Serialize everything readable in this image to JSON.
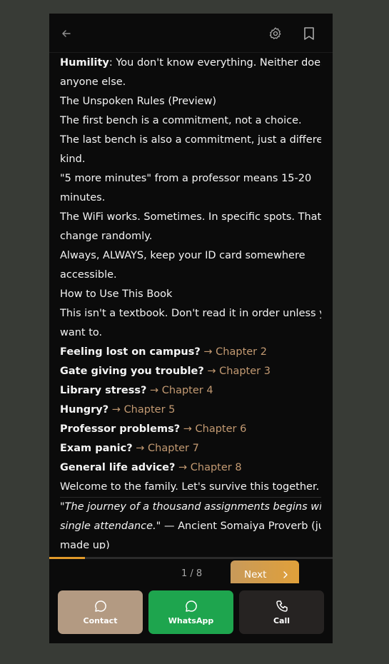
{
  "topbar": {
    "back_icon": "arrow-left-icon",
    "settings_icon": "gear-icon",
    "bookmark_icon": "bookmark-icon"
  },
  "content": {
    "humility_label": "Humility",
    "humility_text_1": ": You don't know everything. Neither does",
    "humility_text_2": "anyone else.",
    "rules_heading": "The Unspoken Rules (Preview)",
    "rule_1": "The first bench is a commitment, not a choice.",
    "rule_2a": "The last bench is also a commitment, just a different",
    "rule_2b": "kind.",
    "rule_3a": "\"5 more minutes\" from a professor means 15-20",
    "rule_3b": "minutes.",
    "rule_4a": "The WiFi works. Sometimes. In specific spots. That",
    "rule_4b": "change randomly.",
    "rule_5a": "Always, ALWAYS, keep your ID card somewhere",
    "rule_5b": "accessible.",
    "howto_heading": "How to Use This Book",
    "howto_a": "This isn't a textbook. Don't read it in order unless you",
    "howto_b": "want to.",
    "guide": [
      {
        "q": "Feeling lost on campus?",
        "arrow": " → ",
        "chapter": "Chapter 2"
      },
      {
        "q": "Gate giving you trouble?",
        "arrow": " → ",
        "chapter": "Chapter 3"
      },
      {
        "q": "Library stress?",
        "arrow": " → ",
        "chapter": "Chapter 4"
      },
      {
        "q": "Hungry?",
        "arrow": " → ",
        "chapter": "Chapter 5"
      },
      {
        "q": "Professor problems?",
        "arrow": " → ",
        "chapter": "Chapter 6"
      },
      {
        "q": "Exam panic?",
        "arrow": " → ",
        "chapter": "Chapter 7"
      },
      {
        "q": "General life advice?",
        "arrow": " → ",
        "chapter": "Chapter 8"
      }
    ],
    "welcome": "Welcome to the family. Let's survive this together.",
    "quote_a": "\"The journey of a thousand assignments begins with a",
    "quote_b": "single attendance.\"",
    "quote_attr_a": " — Ancient Somaiya Proverb (just",
    "quote_attr_b": "made up)"
  },
  "progress": {
    "fraction": 0.125
  },
  "pager": {
    "page_label": "1 / 8",
    "next_label": "Next"
  },
  "actions": {
    "contact": "Contact",
    "whatsapp": "WhatsApp",
    "call": "Call"
  }
}
